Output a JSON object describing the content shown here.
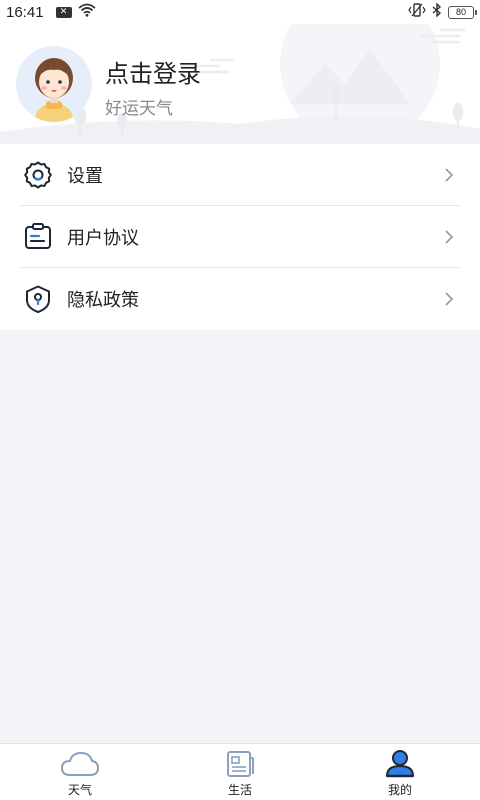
{
  "status_bar": {
    "time": "16:41",
    "notification_badge": "✕",
    "battery_level": "80",
    "icons": [
      "message-icon",
      "wifi-icon",
      "vibrate-icon",
      "bluetooth-icon",
      "battery-icon"
    ]
  },
  "profile": {
    "name": "点击登录",
    "subtitle": "好运天气"
  },
  "menu": {
    "items": [
      {
        "label": "设置",
        "icon": "gear-icon"
      },
      {
        "label": "用户协议",
        "icon": "clipboard-icon"
      },
      {
        "label": "隐私政策",
        "icon": "shield-icon"
      }
    ]
  },
  "tab_bar": {
    "tabs": [
      {
        "label": "天气",
        "icon": "cloud-icon",
        "active": false
      },
      {
        "label": "生活",
        "icon": "news-icon",
        "active": false
      },
      {
        "label": "我的",
        "icon": "user-icon",
        "active": true
      }
    ]
  },
  "colors": {
    "accent": "#2f7fe6",
    "background": "#f3f4f7",
    "inactive_icon": "#8aa0be"
  }
}
